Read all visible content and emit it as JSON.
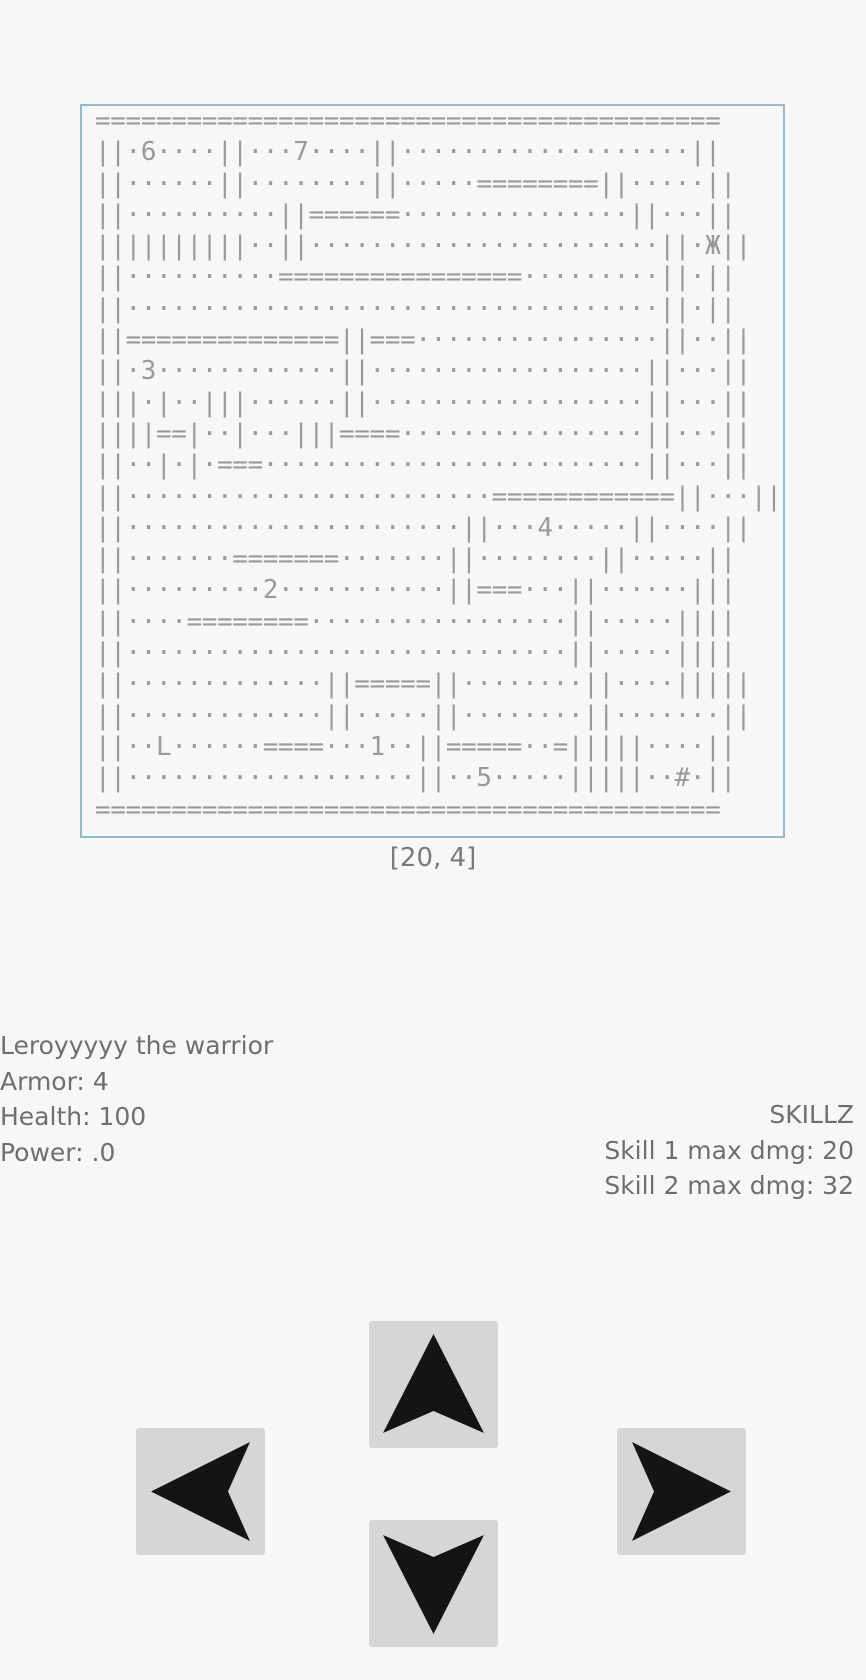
{
  "map": {
    "lines": [
      "=========================================",
      "||·6····||···7····||···················||",
      "||······||········||·····========||·····||",
      "||··········||======···············||···||",
      "||||||||||··||·······················||·Ж||",
      "||··········================·········||·||",
      "||···································||·||",
      "||==============||===················||··||",
      "||·3············||··················||···||",
      "|||·|··|||······||··················||···||",
      "||||==|··|···|||====················||···||",
      "||··|·|·===·························||···||",
      "||························============||···||",
      "||······················||···4·····||····||",
      "||·······=======·······||········||·····||",
      "||·········2···········||===···||······|||",
      "||····========·················||·····||||",
      "||·····························||·····||||",
      "||·············||=====||········||····|||||",
      "||·············||·····||········||·······||",
      "||··L······====···1··||=====··=|||||····||",
      "||···················||··5·····|||||··#·||",
      "========================================="
    ]
  },
  "position_label": "[20, 4]",
  "player": {
    "name_line": "Leroyyyyy the warrior",
    "armor": "Armor: 4",
    "health": "Health: 100",
    "power": "Power: .0"
  },
  "skills": {
    "title": "SKILLZ",
    "skill1": "Skill 1 max dmg: 20",
    "skill2": "Skill 2 max dmg: 32"
  },
  "controls": {
    "up": "arrow-up-icon",
    "down": "arrow-down-icon",
    "left": "arrow-left-icon",
    "right": "arrow-right-icon"
  }
}
